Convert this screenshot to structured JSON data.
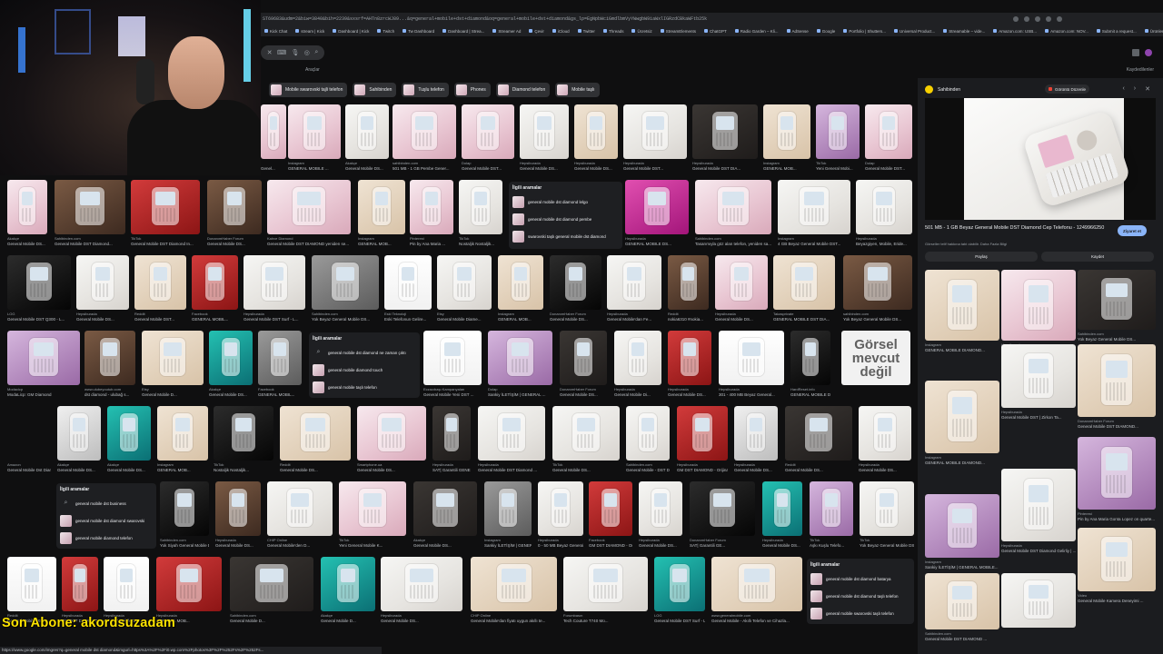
{
  "browser": {
    "url": "ST69683&udm=2&biw=3840&bih=2239&sxsrf=AHTn8zrcWJ89...&q=general+mobile+dst+diamond&oq=general+mobile+dst+diamond&gs_lp=EgNpbWciGmdlbmVyYWwgbW9iaWxlIGRzdCBkaWFtb25k",
    "bookmarks": [
      "Kick Chat",
      "stream | Kick",
      "Dashboard | Kick",
      "Twitch",
      "Tw Dashboard",
      "Dashboard | Strea...",
      "Streamer Ad",
      "Çevir",
      "iCloud",
      "Twitter",
      "Threads",
      "Ücretsiz",
      "StreamElements",
      "ChatGPT",
      "Radio Garden – Kli...",
      "AdSense",
      "Google",
      "Portfolio | Shutters...",
      "Universal Product...",
      "Streamable – vide...",
      "Amazon.com: USB...",
      "Amazon.com: NOV...",
      "Submit a request...",
      "Ürünler",
      "Grow & Listen",
      "Tüm Yer İşaretleri"
    ]
  },
  "search": {
    "tools_label": "Araçlar",
    "saved_label": "Kaydedilenler",
    "chips": [
      "Mobile swarovski tajli telefon",
      "Sahibinden",
      "Tuşlu telefon",
      "Phones",
      "Diamond telefon",
      "Mobile taşlı"
    ]
  },
  "related_boxes": [
    {
      "title": "İlgili aramalar",
      "items": [
        {
          "icon": "thumb",
          "text": "general mobile dst diamond lelgo"
        },
        {
          "icon": "thumb",
          "text": "general mobile dst diamond pembe"
        },
        {
          "icon": "thumb",
          "text": "swarovski taşlı general mobile dst diamond"
        }
      ]
    },
    {
      "title": "İlgili aramalar",
      "items": [
        {
          "icon": "search",
          "text": "general mobile dst diamond ne zaman çıktı"
        },
        {
          "icon": "thumb",
          "text": "general mobile diamond touch"
        },
        {
          "icon": "thumb",
          "text": "general mobile taşlı telefon"
        }
      ]
    },
    {
      "title": "İlgili aramalar",
      "items": [
        {
          "icon": "search",
          "text": "general mobile dst business"
        },
        {
          "icon": "thumb",
          "text": "general mobile dst diamond swarovski"
        },
        {
          "icon": "thumb",
          "text": "general mobile diamond telefon"
        }
      ]
    },
    {
      "title": "İlgili aramalar",
      "items": [
        {
          "icon": "thumb",
          "text": "general mobile dst diamond batarya"
        },
        {
          "icon": "thumb",
          "text": "general mobile dst diamond taşlı telefon"
        },
        {
          "icon": "thumb",
          "text": "general mobile swarovski taşlı telefon"
        }
      ]
    }
  ],
  "noimage": {
    "line1": "Görsel",
    "line2": "mevcut",
    "line3": "değil"
  },
  "tiles": [
    {
      "src": "",
      "title": "Genel...",
      "c": "p-pink"
    },
    {
      "src": "Instagram",
      "title": "GENERAL MOBILE ...",
      "c": "p-pink"
    },
    {
      "src": "Akakçe",
      "title": "General Mobile DS...",
      "c": "p-white"
    },
    {
      "src": "sahibinden.com",
      "title": "501 MB - 1 GB Pembe Gener...",
      "c": "p-pink"
    },
    {
      "src": "Dolap",
      "title": "General Mobile DST...",
      "c": "p-pink"
    },
    {
      "src": "Hepsiburada",
      "title": "General Mobile DS...",
      "c": "p-white"
    },
    {
      "src": "Hepsiburada",
      "title": "General Mobile DS...",
      "c": "p-beige"
    },
    {
      "src": "Hepsiburada",
      "title": "General Mobile DST...",
      "c": "p-white"
    },
    {
      "src": "Hepsiburada",
      "title": "General Mobile DST DIA...",
      "c": "p-dark"
    },
    {
      "src": "Instagram",
      "title": "GENERAL MOB...",
      "c": "p-beige"
    },
    {
      "src": "TikTok",
      "title": "Yeni General Mobi...",
      "c": "p-purple"
    },
    {
      "src": "Dolap",
      "title": "General Mobile DST...",
      "c": "p-pink"
    },
    {
      "src": "Akakçe",
      "title": "General Mobile DS...",
      "c": "p-pink"
    },
    {
      "src": "Sahibinden.com",
      "title": "General Mobile DST Diamond...",
      "c": "p-brown"
    },
    {
      "src": "TikTok",
      "title": "General Mobile DST Diamond In...",
      "c": "p-red"
    },
    {
      "src": "DonanımHaber Forum",
      "title": "General Mobile DS...",
      "c": "p-brown"
    },
    {
      "src": "Kahve Diamond",
      "title": "General Mobile DST DIAMOND yeniden se...",
      "c": "p-pink"
    },
    {
      "src": "Instagram",
      "title": "GENERAL MOB...",
      "c": "p-beige"
    },
    {
      "src": "Pinterest",
      "title": "Pin by Ana Maria ...",
      "c": "p-pink"
    },
    {
      "src": "TikTok",
      "title": "Nostaljik Nostaljik...",
      "c": "p-white"
    },
    {
      "src": "Hepsiburada",
      "title": "GENERAL MOBILE DS...",
      "c": "p-magenta"
    },
    {
      "src": "Sahibinden.com",
      "title": "Tasarımıyla göz alan telefon, yeniden sa...",
      "c": "p-pink"
    },
    {
      "src": "Instagram",
      "title": "4 GB Beyaz General Mobile DST...",
      "c": "p-white"
    },
    {
      "src": "Hepsiburada",
      "title": "Beyazgiyen, Mobile, Eride...",
      "c": "p-white"
    },
    {
      "src": "LOG",
      "title": "General Mobile DST Q300 - L...",
      "c": "p-black"
    },
    {
      "src": "Hepsiburada",
      "title": "General Mobile DS...",
      "c": "p-white"
    },
    {
      "src": "Reddit",
      "title": "General Mobile DST...",
      "c": "p-beige"
    },
    {
      "src": "Facebook",
      "title": "GENERAL MOBIL...",
      "c": "p-red"
    },
    {
      "src": "Hepsiburada",
      "title": "General Mobile DST Surf - L...",
      "c": "p-white"
    },
    {
      "src": "Sahibinden.com",
      "title": "Yok Beyaz General Mobile DS...",
      "c": "p-grey"
    },
    {
      "src": "Eski Teknoloji",
      "title": "Eski Telefonun Gelire...",
      "c": "p-doc"
    },
    {
      "src": "Etsy",
      "title": "General Mobile Diame...",
      "c": "p-white"
    },
    {
      "src": "Instagram",
      "title": "GENERAL MOB...",
      "c": "p-beige"
    },
    {
      "src": "DonanımHaber Forum",
      "title": "General Mobile DS...",
      "c": "p-black"
    },
    {
      "src": "Hepsiburada",
      "title": "General Mobile'dan Fe...",
      "c": "p-white"
    },
    {
      "src": "Reddit",
      "title": "nokia6310 #nokia...",
      "c": "p-brown"
    },
    {
      "src": "Hepsiburada",
      "title": "General Mobile DS...",
      "c": "p-pink"
    },
    {
      "src": "Takasprivate",
      "title": "GENERAL MOBILE DST DIA...",
      "c": "p-beige"
    },
    {
      "src": "sahibinden.com",
      "title": "Yok Beyaz General Mobile DS...",
      "c": "p-brown"
    },
    {
      "src": "Modacicp",
      "title": "ModaLicp: GM Diamond",
      "c": "p-purple"
    },
    {
      "src": "www.ulubeyoutub.com",
      "title": "dst diamond - ulubağ s...",
      "c": "p-brown"
    },
    {
      "src": "Etsy",
      "title": "General Mobile D...",
      "c": "p-beige"
    },
    {
      "src": "Akakçe",
      "title": "General Mobile DS...",
      "c": "p-teal"
    },
    {
      "src": "Facebook",
      "title": "GENERAL MOBIL...",
      "c": "p-grey"
    },
    {
      "src": "Eczacıbaşı Kampanyaları",
      "title": "General Mobile Yeni DST ...",
      "c": "p-doc"
    },
    {
      "src": "Dolap",
      "title": "Sankiy İLETİŞİM | GENERAL ...",
      "c": "p-purple"
    },
    {
      "src": "DonanımHaber Forum",
      "title": "General Mobile DS...",
      "c": "p-dark"
    },
    {
      "src": "Hepsiburada",
      "title": "General Mobile Di...",
      "c": "p-white"
    },
    {
      "src": "Hepsiburada",
      "title": "General Mobile DS...",
      "c": "p-red"
    },
    {
      "src": "Hepsiburada",
      "title": "301 - 400 MB Beyaz General...",
      "c": "p-doc"
    },
    {
      "src": "HardReset.info",
      "title": "GENERAL MOBILE DS...",
      "c": "p-black"
    },
    {
      "src": "Amazon",
      "title": "General Mobile Dst Diamond A Ka...",
      "c": ""
    },
    {
      "src": "Akakçe",
      "title": "General Mobile DS...",
      "c": "p-silver"
    },
    {
      "src": "Akakçe",
      "title": "General Mobile DS...",
      "c": "p-teal"
    },
    {
      "src": "Instagram",
      "title": "GENERAL MOB...",
      "c": "p-beige"
    },
    {
      "src": "TikTok",
      "title": "Nostaljik Nostaljik...",
      "c": "p-black"
    },
    {
      "src": "Reddit",
      "title": "General Mobile DS...",
      "c": "p-beige"
    },
    {
      "src": "Smartphone.ua",
      "title": "General Mobile DS...",
      "c": "p-pink"
    },
    {
      "src": "Hepsiburada",
      "title": "SAT| Garantili GENERAL MOBI...",
      "c": "p-dark"
    },
    {
      "src": "Hepsiburada",
      "title": "General Mobile DST Diamond ...",
      "c": "p-white"
    },
    {
      "src": "TikTok",
      "title": "General Mobile DS...",
      "c": "p-white"
    },
    {
      "src": "Sahibinden.com",
      "title": "General Mobile - DST Diamond ...",
      "c": "p-white"
    },
    {
      "src": "Hepsiburada",
      "title": "GM DST DIAMOND - Orijinal Ka...",
      "c": "p-red"
    },
    {
      "src": "Hepsiburada",
      "title": "General Mobile DS...",
      "c": "p-silver"
    },
    {
      "src": "Reddit",
      "title": "General Mobile DS...",
      "c": "p-dark"
    },
    {
      "src": "Hepsiburada",
      "title": "General Mobile DS...",
      "c": "p-white"
    },
    {
      "src": "Sahibinden.com",
      "title": "Yok Siyah General Mobile DS...",
      "c": "p-black"
    },
    {
      "src": "Hepsiburada",
      "title": "General Mobile DS...",
      "c": "p-brown"
    },
    {
      "src": "CHIP Online",
      "title": "General Mobile'den D...",
      "c": "p-white"
    },
    {
      "src": "TikTok",
      "title": "Yeni General Mobile K...",
      "c": "p-pink"
    },
    {
      "src": "Akakçe",
      "title": "General Mobile DS...",
      "c": "p-dark"
    },
    {
      "src": "Instagram",
      "title": "Sankiy İLETİŞİM | GENERAL ...",
      "c": "p-grey"
    },
    {
      "src": "Hepsiburada",
      "title": "0 - 50 MB Beyaz General Mobi...",
      "c": "p-white"
    },
    {
      "src": "Facebook",
      "title": "GM DST DIAMOND - Orjinal K...",
      "c": "p-red"
    },
    {
      "src": "Hepsiburada",
      "title": "General Mobile DS...",
      "c": "p-white"
    },
    {
      "src": "DonanımHaber Forum",
      "title": "SAT| Garantili GE...",
      "c": "p-black"
    },
    {
      "src": "Hepsiburada",
      "title": "General Mobile DS...",
      "c": "p-teal"
    },
    {
      "src": "TikTok",
      "title": "Aşkı Kuşlu Telefo...",
      "c": "p-purple"
    },
    {
      "src": "TikTok",
      "title": "Yok Beyaz General Mobile DS...",
      "c": "p-white"
    },
    {
      "src": "Reddit",
      "title": "General Mobile DS...",
      "c": "p-doc"
    },
    {
      "src": "Hepsiburada",
      "title": "GM DST DIAMOND ...",
      "c": "p-red"
    },
    {
      "src": "Hepsiburada",
      "title": "General Mobile DS...",
      "c": "p-doc"
    },
    {
      "src": "Hepsiburada",
      "title": "GENERAL MOB...",
      "c": "p-red"
    },
    {
      "src": "Sahibinden.com",
      "title": "General Mobile D...",
      "c": "p-dark"
    },
    {
      "src": "Akakçe",
      "title": "General Mobile D...",
      "c": "p-teal"
    },
    {
      "src": "Hepsiburada",
      "title": "General Mobile DS...",
      "c": "p-white"
    },
    {
      "src": "CHIP Online",
      "title": "General Mobile'dan fiyatı uygun akıllı te...",
      "c": "p-beige"
    },
    {
      "src": "Forumbasın",
      "title": "Tech Couture T740 Mo...",
      "c": "p-white"
    },
    {
      "src": "LOG",
      "title": "General Mobile DST Surf - LOG",
      "c": "p-teal"
    },
    {
      "src": "www.generalmobile.com",
      "title": "General Mobile - Akıllı Telefon ve Cihazla...",
      "c": "p-beige"
    },
    {
      "src": "YouTube",
      "title": "Mobiinel EL600 Dual Chinese mobile ph...",
      "c": "p-white"
    },
    {
      "src": "Gardrops",
      "title": "Xiaomi MI XIAOMI SC...",
      "c": "p-beige"
    },
    {
      "src": "www.generalmobile.com",
      "title": "General Mobile - Akıllı Telefon ve Cihazla...",
      "c": "p-silver"
    }
  ],
  "panel": {
    "source": "Sahibinden",
    "gdb_label": "Görüntü Düzenle",
    "title": "501 MB - 1 GB Beyaz General Mobile DST Diamond Cep Telefonu - 1249966250",
    "note": "Görseller telif hakkına tabi olabilir. Daha Fazla Bilgi",
    "visit": "Ziyaret et",
    "share": "Paylaş",
    "save": "Kaydet",
    "tiles": [
      {
        "src": "Instagram",
        "title": "GENERAL MOBILE DIAMOND...",
        "c": "p-beige"
      },
      {
        "src": "Hepsiburada",
        "title": "General Mobile DST Diamond Limited...",
        "c": "p-pink"
      },
      {
        "src": "Sahibinden.com",
        "title": "Yok Beyaz General Mobile DS...",
        "c": "p-dark"
      },
      {
        "src": "Instagram",
        "title": "GENERAL MOBILE DIAMOND...",
        "c": "p-beige"
      },
      {
        "src": "Hepsiburada",
        "title": "General Mobile DST | Zirkon Ta...",
        "c": "p-white"
      },
      {
        "src": "DonanımHaber Forum",
        "title": "General Mobile DST DIAMOND...",
        "c": "p-beige"
      },
      {
        "src": "Hepsiburada",
        "title": "General Mobile DST Diamond Gelirliy | ...",
        "c": "p-white"
      },
      {
        "src": "Pinterest",
        "title": "Pin by Ana Maria Gonta Lopez on quarte...",
        "c": "p-purple"
      },
      {
        "src": "Instagram",
        "title": "Sankiy İLETİŞİM | GENERAL MOBILE...",
        "c": "p-purple"
      },
      {
        "src": "Video",
        "title": "General Mobile Kamera Deneyimi ...",
        "c": "p-beige"
      },
      {
        "src": "Sahibinden.com",
        "title": "General Mobile DST DIAMOND ...",
        "c": "p-beige"
      },
      {
        "src": "",
        "title": "",
        "c": "p-white"
      }
    ]
  },
  "overlay": {
    "subscriber": "Son Abone: akordsuzadam",
    "status_url": "https://www.google.com/imgres?q=general mobile dst diamond&imgurl=https%3A%2F%2Fi0.wp.com%2Fphotos%3F%2F%252Fs%2F%252Fs..."
  }
}
